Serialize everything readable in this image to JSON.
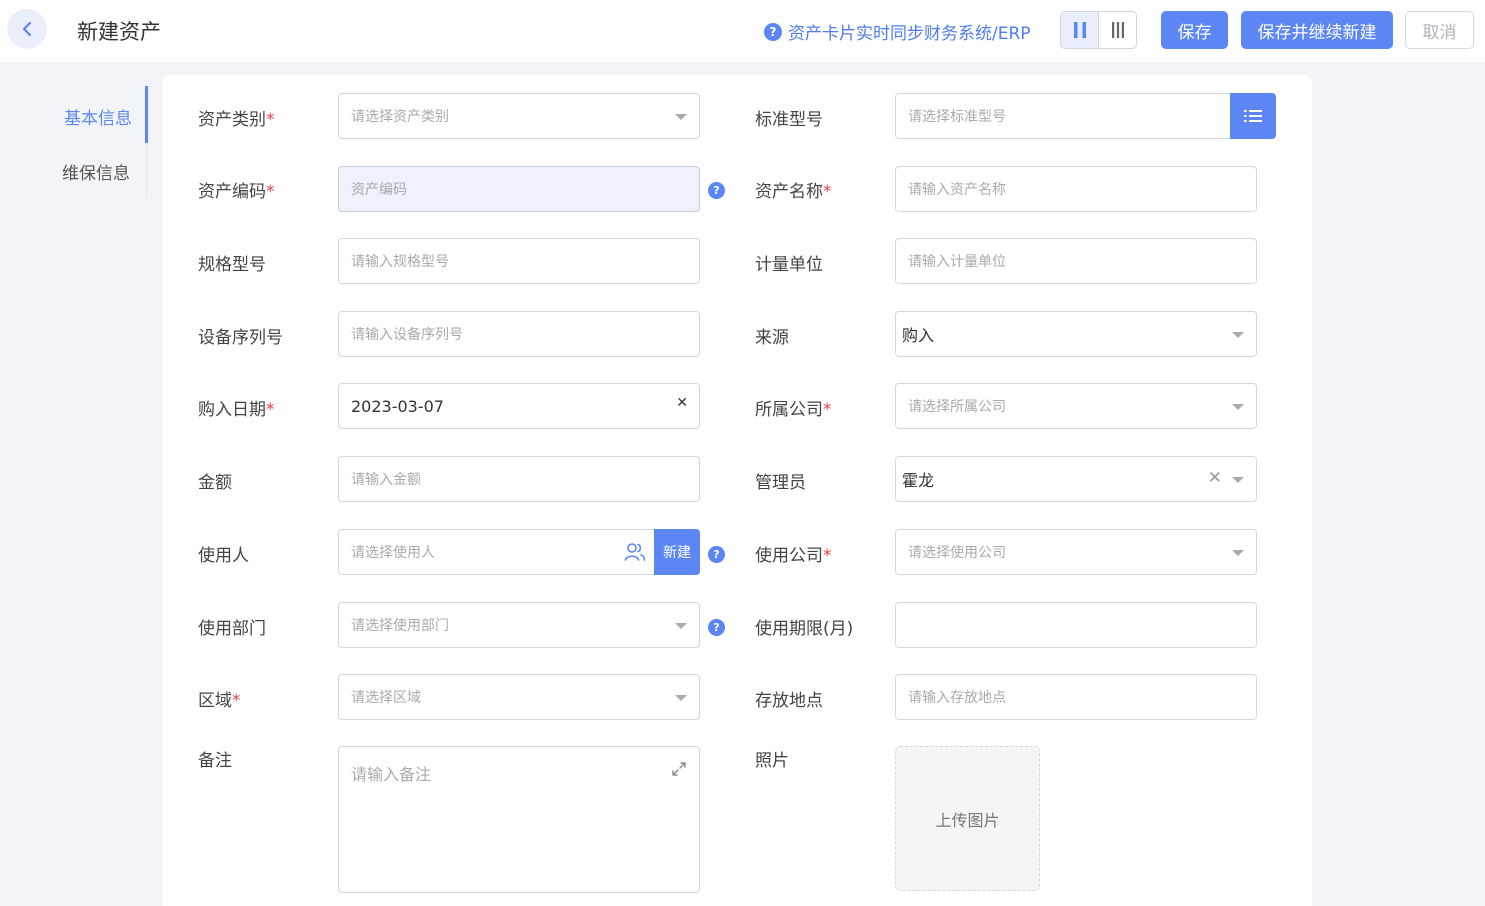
{
  "header": {
    "title": "新建资产",
    "sync_link": "资产卡片实时同步财务系统/ERP",
    "save_label": "保存",
    "save_and_new_label": "保存并继续新建",
    "cancel_label": "取消"
  },
  "sidebar": {
    "items": [
      {
        "label": "基本信息",
        "active": true
      },
      {
        "label": "维保信息",
        "active": false
      }
    ]
  },
  "form": {
    "asset_category": {
      "label": "资产类别",
      "placeholder": "请选择资产类别"
    },
    "standard_model": {
      "label": "标准型号",
      "placeholder": "请选择标准型号"
    },
    "asset_code": {
      "label": "资产编码",
      "placeholder": "资产编码"
    },
    "asset_name": {
      "label": "资产名称",
      "placeholder": "请输入资产名称"
    },
    "spec_model": {
      "label": "规格型号",
      "placeholder": "请输入规格型号"
    },
    "unit": {
      "label": "计量单位",
      "placeholder": "请输入计量单位"
    },
    "serial_no": {
      "label": "设备序列号",
      "placeholder": "请输入设备序列号"
    },
    "source": {
      "label": "来源",
      "value": "购入"
    },
    "purchase_date": {
      "label": "购入日期",
      "value": "2023-03-07"
    },
    "company": {
      "label": "所属公司",
      "placeholder": "请选择所属公司"
    },
    "amount": {
      "label": "金额",
      "placeholder": "请输入金额"
    },
    "manager": {
      "label": "管理员",
      "value": "霍龙"
    },
    "user": {
      "label": "使用人",
      "placeholder": "请选择使用人",
      "new_label": "新建"
    },
    "use_company": {
      "label": "使用公司",
      "placeholder": "请选择使用公司"
    },
    "department": {
      "label": "使用部门",
      "placeholder": "请选择使用部门"
    },
    "use_period": {
      "label": "使用期限(月)",
      "value": ""
    },
    "region": {
      "label": "区域",
      "placeholder": "请选择区域"
    },
    "location": {
      "label": "存放地点",
      "placeholder": "请输入存放地点"
    },
    "remark": {
      "label": "备注",
      "placeholder": "请输入备注"
    },
    "photo": {
      "label": "照片",
      "upload_label": "上传图片"
    }
  },
  "required_mark": "*",
  "colors": {
    "accent": "#5b86f4",
    "required": "#f04343"
  }
}
